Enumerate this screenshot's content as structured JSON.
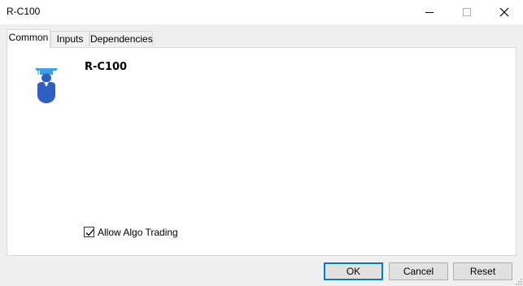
{
  "window": {
    "title": "R-C100"
  },
  "titlebar": {
    "minimize_icon": "minimize-icon",
    "maximize_icon": "maximize-icon",
    "close_icon": "close-icon"
  },
  "tabs": [
    {
      "label": "Common",
      "active": true
    },
    {
      "label": "Inputs",
      "active": false
    },
    {
      "label": "Dependencies",
      "active": false
    }
  ],
  "common": {
    "ea_icon": "graduate-avatar-icon",
    "ea_name": "R-C100",
    "allow_algo_trading_label": "Allow Algo Trading",
    "allow_algo_trading_checked": true
  },
  "buttons": {
    "ok_label": "OK",
    "cancel_label": "Cancel",
    "reset_label": "Reset"
  },
  "colors": {
    "accent": "#0078d7",
    "avatar_blue": "#2f5ec4",
    "cap_blue": "#3aa0e8"
  }
}
